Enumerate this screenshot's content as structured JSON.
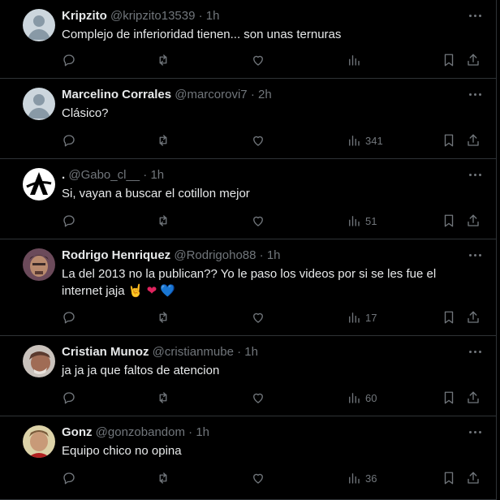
{
  "replies": [
    {
      "name": "Kripzito",
      "handle": "@kripzito13539",
      "dot": "·",
      "time": "1h",
      "text": "Complejo de inferioridad tienen... son unas ternuras",
      "views": "",
      "avatar": "default"
    },
    {
      "name": "Marcelino Corrales",
      "handle": "@marcorovi7",
      "dot": "·",
      "time": "2h",
      "text": "Clásico?",
      "views": "341",
      "avatar": "default"
    },
    {
      "name": ".",
      "handle": "@Gabo_cl__",
      "dot": "·",
      "time": "1h",
      "text": "Si, vayan a buscar el cotillon mejor",
      "views": "51",
      "avatar": "logo"
    },
    {
      "name": "Rodrigo Henriquez",
      "handle": "@Rodrigoho88",
      "dot": "·",
      "time": "1h",
      "text": "La del 2013 no la publican?? Yo le paso los videos por si se les fue el internet jaja",
      "emojis": [
        "🤘",
        "❤",
        "💙"
      ],
      "views": "17",
      "avatar": "photo"
    },
    {
      "name": "Cristian Munoz",
      "handle": "@cristianmube",
      "dot": "·",
      "time": "1h",
      "text": "ja ja ja que faltos de atencion",
      "views": "60",
      "avatar": "photo"
    },
    {
      "name": "Gonz",
      "handle": "@gonzobandom",
      "dot": "·",
      "time": "1h",
      "text": "Equipo chico no opina",
      "views": "36",
      "avatar": "photo"
    }
  ],
  "icons": {
    "reply": "reply-icon",
    "retweet": "retweet-icon",
    "like": "like-icon",
    "views": "views-icon",
    "bookmark": "bookmark-icon",
    "share": "share-icon",
    "more": "more-icon"
  },
  "colors": {
    "background": "#000000",
    "text": "#e7e9ea",
    "muted": "#71767b",
    "border": "#2f3336"
  }
}
